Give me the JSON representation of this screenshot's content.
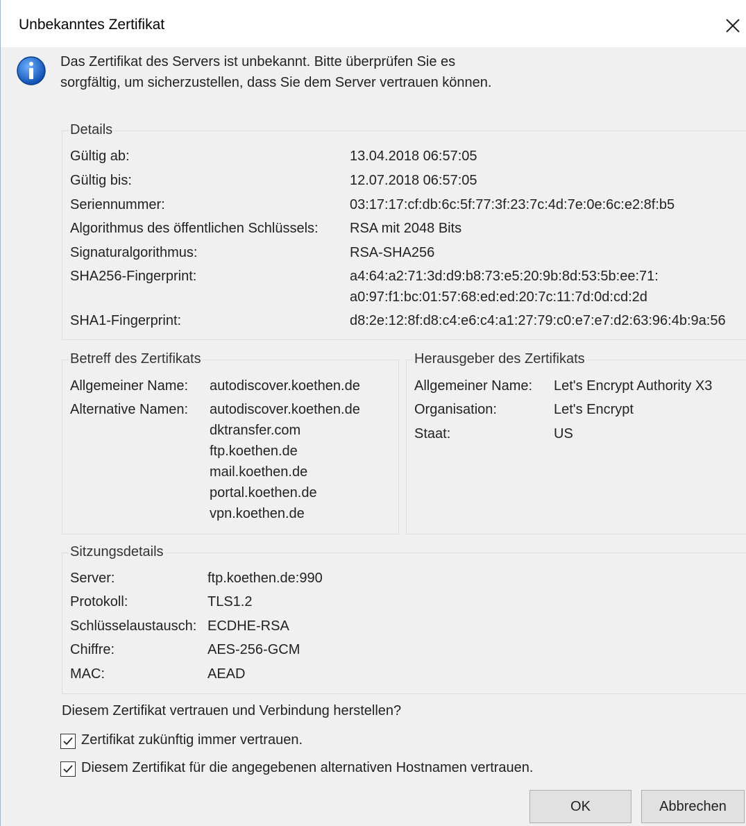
{
  "window": {
    "title": "Unbekanntes Zertifikat"
  },
  "message": "Das Zertifikat des Servers ist unbekannt. Bitte überprüfen Sie es sorgfältig, um sicherzustellen, dass Sie dem Server vertrauen können.",
  "details": {
    "legend": "Details",
    "rows": [
      {
        "label": "Gültig ab:",
        "value": "13.04.2018 06:57:05"
      },
      {
        "label": "Gültig bis:",
        "value": "12.07.2018 06:57:05"
      },
      {
        "label": "Seriennummer:",
        "value": "03:17:17:cf:db:6c:5f:77:3f:23:7c:4d:7e:0e:6c:e2:8f:b5"
      },
      {
        "label": "Algorithmus des öffentlichen Schlüssels:",
        "value": "RSA mit 2048 Bits"
      },
      {
        "label": "Signaturalgorithmus:",
        "value": "RSA-SHA256"
      },
      {
        "label": "SHA256-Fingerprint:",
        "value": "a4:64:a2:71:3d:d9:b8:73:e5:20:9b:8d:53:5b:ee:71:",
        "value2": "a0:97:f1:bc:01:57:68:ed:ed:20:7c:11:7d:0d:cd:2d"
      },
      {
        "label": "SHA1-Fingerprint:",
        "value": "d8:2e:12:8f:d8:c4:e6:c4:a1:27:79:c0:e7:e7:d2:63:96:4b:9a:56"
      }
    ]
  },
  "subject": {
    "legend": "Betreff des Zertifikats",
    "common_name_label": "Allgemeiner Name:",
    "common_name": "autodiscover.koethen.de",
    "alt_names_label": "Alternative Namen:",
    "alt_names": [
      "autodiscover.koethen.de",
      "dktransfer.com",
      "ftp.koethen.de",
      "mail.koethen.de",
      "portal.koethen.de",
      "vpn.koethen.de"
    ]
  },
  "issuer": {
    "legend": "Herausgeber des Zertifikats",
    "rows": [
      {
        "label": "Allgemeiner Name:",
        "value": "Let's Encrypt Authority X3"
      },
      {
        "label": "Organisation:",
        "value": "Let's Encrypt"
      },
      {
        "label": "Staat:",
        "value": "US"
      }
    ]
  },
  "session": {
    "legend": "Sitzungsdetails",
    "rows": [
      {
        "label": "Server:",
        "value": "ftp.koethen.de:990"
      },
      {
        "label": "Protokoll:",
        "value": "TLS1.2"
      },
      {
        "label": "Schlüsselaustausch:",
        "value": "ECDHE-RSA"
      },
      {
        "label": "Chiffre:",
        "value": "AES-256-GCM"
      },
      {
        "label": "MAC:",
        "value": "AEAD"
      }
    ]
  },
  "question": "Diesem Zertifikat vertrauen und Verbindung herstellen?",
  "checkboxes": [
    {
      "label": "Zertifikat zukünftig immer vertrauen.",
      "checked": true
    },
    {
      "label": "Diesem Zertifikat für die angegebenen alternativen Hostnamen vertrauen.",
      "checked": true
    }
  ],
  "buttons": {
    "ok": "OK",
    "cancel": "Abbrechen"
  },
  "icons": {
    "info": "info-icon",
    "close": "close-icon",
    "check": "checkmark-icon"
  },
  "colors": {
    "info_blue": "#1a6fd1",
    "dialog_bg": "#f0f0f0",
    "button_bg": "#e1e1e1"
  }
}
